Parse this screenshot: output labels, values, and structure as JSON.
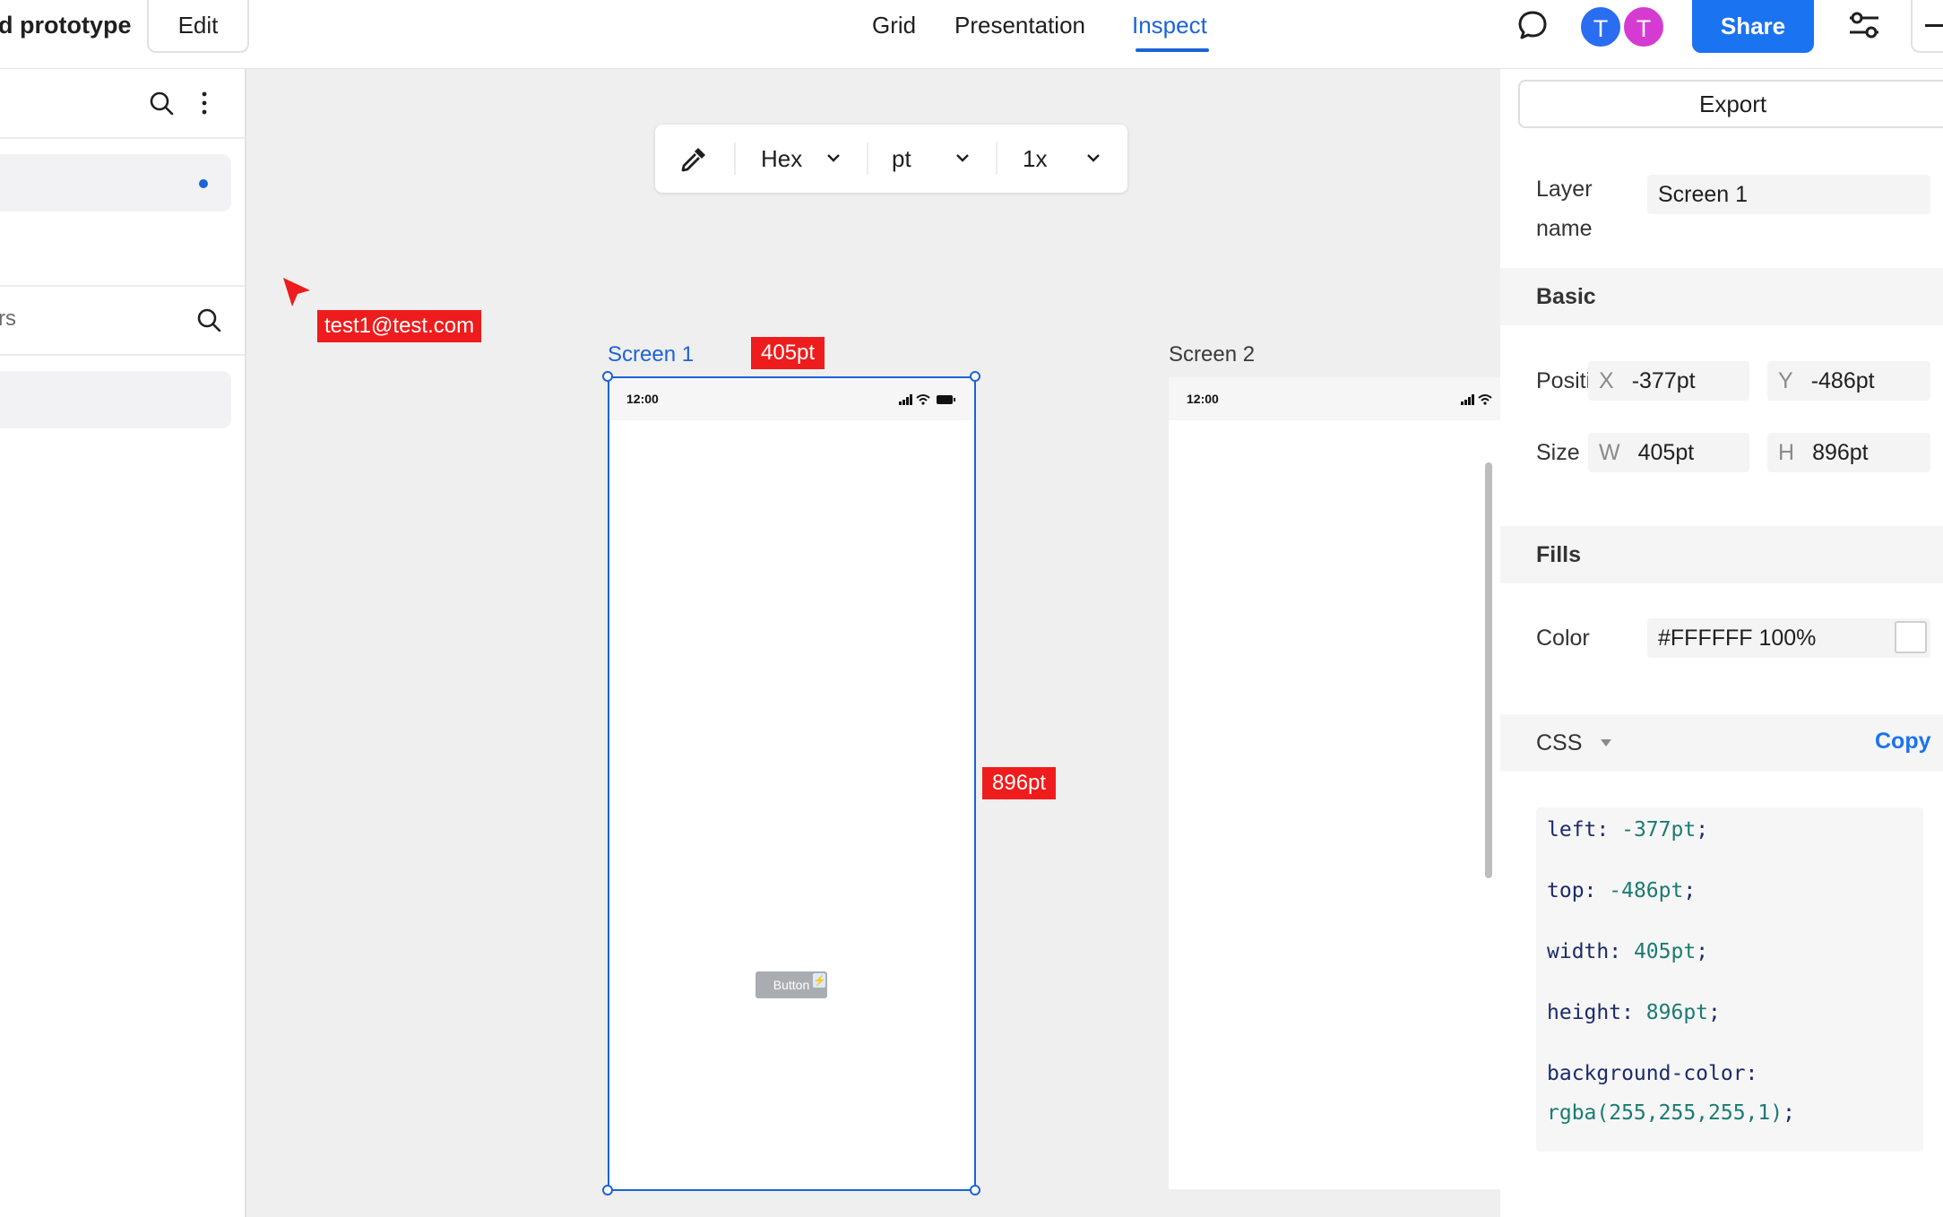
{
  "header": {
    "title": "d prototype",
    "edit_label": "Edit",
    "tabs": [
      {
        "label": "Grid",
        "active": false
      },
      {
        "label": "Presentation",
        "active": false
      },
      {
        "label": "Inspect",
        "active": true
      }
    ],
    "avatars": [
      {
        "initial": "T",
        "color": "#2a6df0"
      },
      {
        "initial": "T",
        "color": "#d63bd1"
      }
    ],
    "share_label": "Share"
  },
  "left_panel": {
    "search_partial": "rs"
  },
  "canvas": {
    "toolbar": {
      "color_format": "Hex",
      "unit": "pt",
      "scale": "1x"
    },
    "cursor": {
      "user": "test1@test.com"
    },
    "frames": [
      {
        "label": "Screen 1",
        "selected": true,
        "time": "12:00",
        "button_label": "Button",
        "width_tag": "405pt",
        "height_tag": "896pt"
      },
      {
        "label": "Screen 2",
        "selected": false,
        "time": "12:00"
      }
    ]
  },
  "inspect": {
    "export_label": "Export",
    "layer_name_label": "Layer name",
    "layer_name": "Screen 1",
    "basic": {
      "title": "Basic",
      "position_label": "Positi",
      "x_axis": "X",
      "x": "-377pt",
      "y_axis": "Y",
      "y": "-486pt",
      "size_label": "Size",
      "w_axis": "W",
      "w": "405pt",
      "h_axis": "H",
      "h": "896pt"
    },
    "fills": {
      "title": "Fills",
      "color_label": "Color",
      "color_value": "#FFFFFF 100%"
    },
    "css": {
      "title": "CSS",
      "copy_label": "Copy",
      "lines": [
        {
          "prop": "left: ",
          "value": "-377pt",
          "end": ";"
        },
        {
          "prop": "top: ",
          "value": "-486pt",
          "end": ";"
        },
        {
          "prop": "width: ",
          "value": "405pt",
          "end": ";"
        },
        {
          "prop": "height: ",
          "value": "896pt",
          "end": ";"
        },
        {
          "prop": "background-color:",
          "value": "",
          "end": ""
        },
        {
          "prop": "",
          "value": "rgba(255,255,255,1)",
          "end": ";"
        }
      ]
    }
  },
  "colors": {
    "accent": "#1c63d6",
    "share": "#1a73f0",
    "tag_red": "#ee1c1c"
  }
}
